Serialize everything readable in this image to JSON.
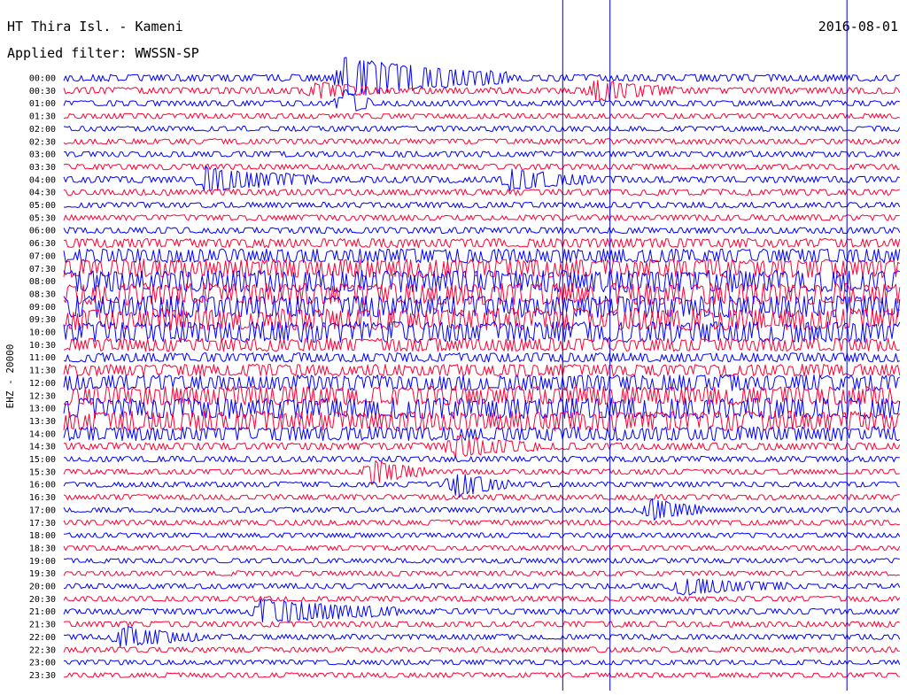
{
  "header": {
    "station": "HT Thira Isl. - Kameni",
    "filter": "Applied filter: WWSSN-SP",
    "date": "2016-08-01"
  },
  "channel_label": "EHZ - 20000",
  "colors": {
    "trace_a": "#0000ff",
    "trace_b": "#ff0033",
    "marker": "#0000cc",
    "background": "#ffffff",
    "text": "#000000"
  },
  "chart_data": {
    "type": "helicorder",
    "title": "HT Thira Isl. - Kameni",
    "subtitle": "Applied filter: WWSSN-SP",
    "date": "2016-08-01",
    "ylabel": "EHZ - 20000",
    "row_minutes": 30,
    "row_labels": [
      "00:00",
      "00:30",
      "01:00",
      "01:30",
      "02:00",
      "02:30",
      "03:00",
      "03:30",
      "04:00",
      "04:30",
      "05:00",
      "05:30",
      "06:00",
      "06:30",
      "07:00",
      "07:30",
      "08:00",
      "08:30",
      "09:00",
      "09:30",
      "10:00",
      "10:30",
      "11:00",
      "11:30",
      "12:00",
      "12:30",
      "13:00",
      "13:30",
      "14:00",
      "14:30",
      "15:00",
      "15:30",
      "16:00",
      "16:30",
      "17:00",
      "17:30",
      "18:00",
      "18:30",
      "19:00",
      "19:30",
      "20:00",
      "20:30",
      "21:00",
      "21:30",
      "22:00",
      "22:30",
      "23:00",
      "23:30"
    ],
    "display_labels": [
      "00:00",
      "00:30",
      "01:00",
      "01:30",
      "02:00",
      "02:30",
      "03:00",
      "03:30",
      "04:00",
      "04:30",
      "05:00",
      "05:30",
      "06:00",
      "06:30",
      "07:00",
      "07:30",
      "08:00",
      "08:30",
      "09:00",
      "09:30",
      "10:00",
      "10:30",
      "11:00",
      "11:30",
      "12:00",
      "12:30",
      "13:00",
      "13:30",
      "14:00",
      "14:30",
      "15:00",
      "15:30",
      "16:00",
      "16:30",
      "17:00",
      "17:30",
      "18:00",
      "18:30",
      "19:00",
      "19:30",
      "20:00",
      "20:30",
      "21:00",
      "21:30",
      "22:00",
      "22:30",
      "23:00",
      "23:30"
    ],
    "row_colors": [
      "trace_a",
      "trace_b"
    ],
    "row_amplitude": [
      0.25,
      0.22,
      0.18,
      0.16,
      0.16,
      0.16,
      0.18,
      0.18,
      0.22,
      0.2,
      0.18,
      0.18,
      0.2,
      0.35,
      0.6,
      0.85,
      1.0,
      1.0,
      1.0,
      1.0,
      0.95,
      0.55,
      0.35,
      0.5,
      0.7,
      0.85,
      0.95,
      0.9,
      0.6,
      0.25,
      0.18,
      0.16,
      0.16,
      0.16,
      0.16,
      0.16,
      0.14,
      0.14,
      0.14,
      0.14,
      0.16,
      0.16,
      0.18,
      0.18,
      0.16,
      0.16,
      0.14,
      0.14
    ],
    "events": [
      {
        "row": 0,
        "minute": 10,
        "duration": 6,
        "strength": 1.0
      },
      {
        "row": 1,
        "minute": 19,
        "duration": 3,
        "strength": 0.5
      },
      {
        "row": 1,
        "minute": 9,
        "duration": 2,
        "strength": 0.4
      },
      {
        "row": 2,
        "minute": 10,
        "duration": 1,
        "strength": 0.8
      },
      {
        "row": 8,
        "minute": 5,
        "duration": 4,
        "strength": 0.6
      },
      {
        "row": 8,
        "minute": 16,
        "duration": 3,
        "strength": 0.5
      },
      {
        "row": 29,
        "minute": 14,
        "duration": 3,
        "strength": 0.5
      },
      {
        "row": 31,
        "minute": 11,
        "duration": 2,
        "strength": 0.6
      },
      {
        "row": 32,
        "minute": 14,
        "duration": 2,
        "strength": 0.7
      },
      {
        "row": 34,
        "minute": 21,
        "duration": 2,
        "strength": 0.6
      },
      {
        "row": 42,
        "minute": 7,
        "duration": 5,
        "strength": 0.6
      },
      {
        "row": 44,
        "minute": 2,
        "duration": 3,
        "strength": 0.5
      },
      {
        "row": 40,
        "minute": 22,
        "duration": 4,
        "strength": 0.4
      }
    ],
    "vertical_markers_minute": [
      17.9,
      19.6,
      28.1
    ],
    "grid": false
  }
}
